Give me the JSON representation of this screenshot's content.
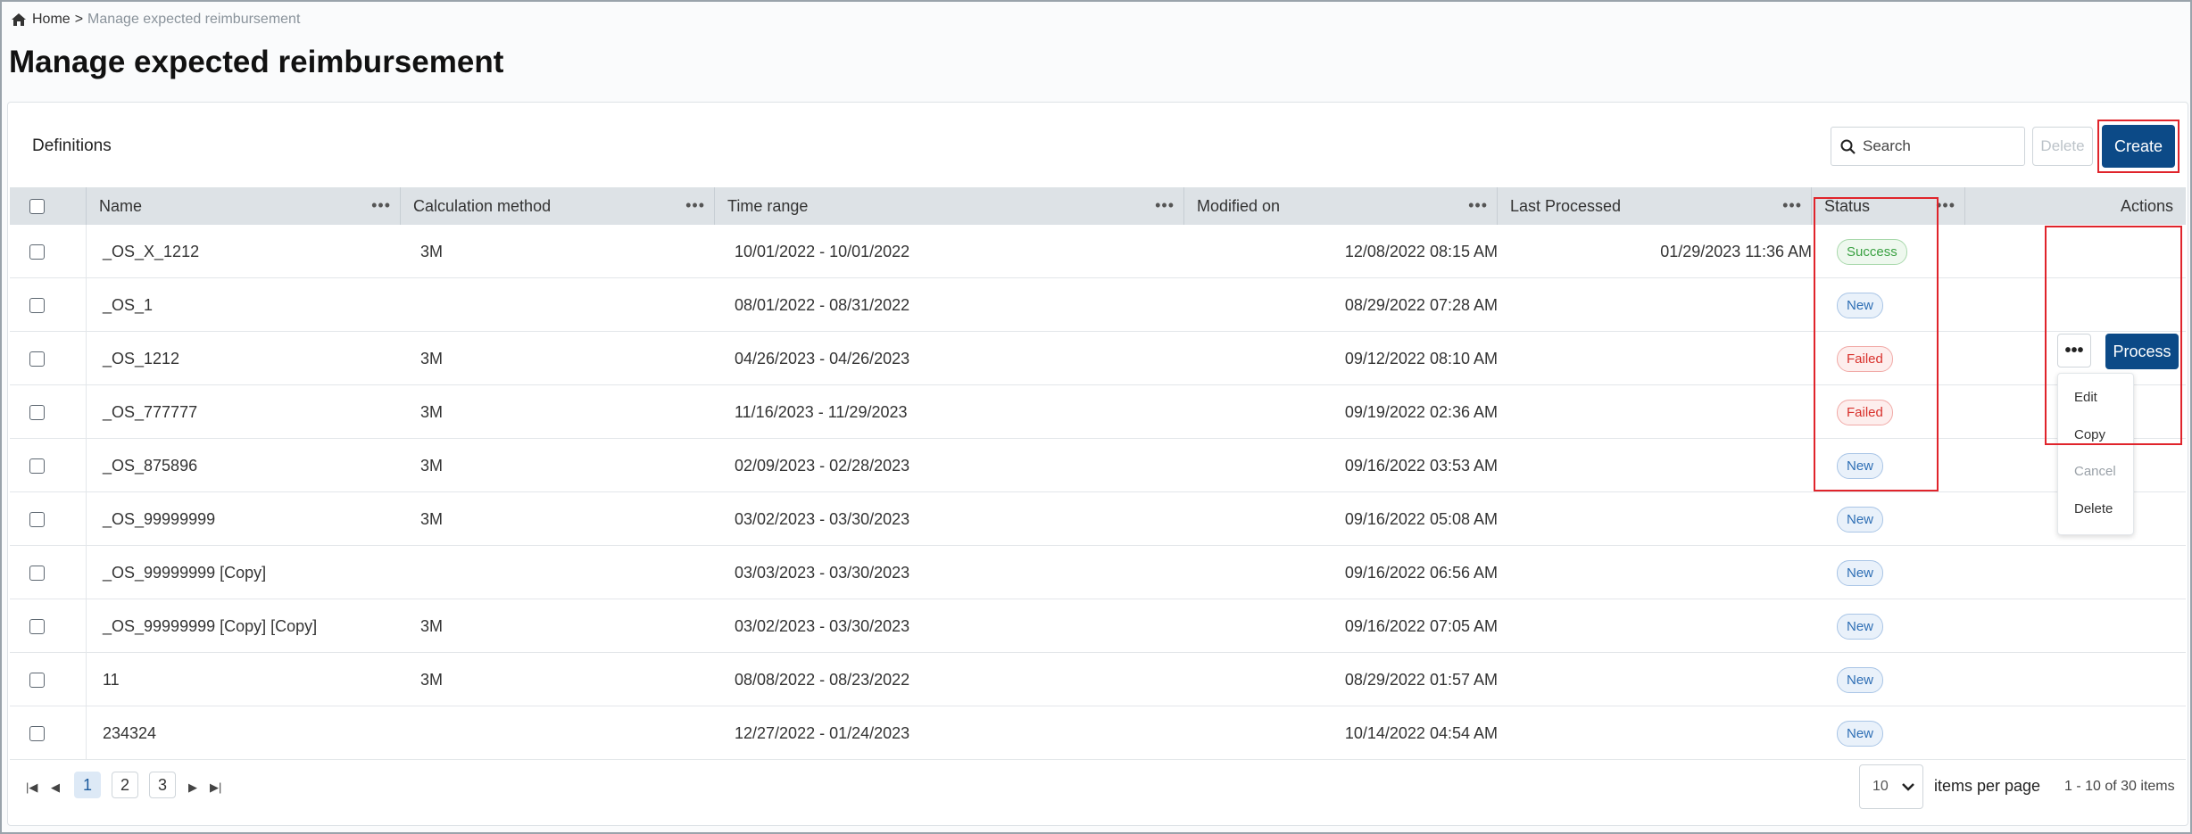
{
  "breadcrumb": {
    "home": "Home",
    "separator": ">",
    "current": "Manage expected reimbursement"
  },
  "page_title": "Manage expected reimbursement",
  "section_title": "Definitions",
  "toolbar": {
    "search_placeholder": "Search",
    "delete_label": "Delete",
    "create_label": "Create"
  },
  "columns": [
    "Name",
    "Calculation method",
    "Time range",
    "Modified on",
    "Last Processed",
    "Status",
    "Actions"
  ],
  "rows": [
    {
      "name": "_OS_X_1212",
      "method": "3M",
      "time_range": "10/01/2022 - 10/01/2022",
      "modified_on": "12/08/2022 08:15 AM",
      "last_processed": "01/29/2023 11:36 AM",
      "status": "Success"
    },
    {
      "name": "_OS_1",
      "method": "",
      "time_range": "08/01/2022 - 08/31/2022",
      "modified_on": "08/29/2022 07:28 AM",
      "last_processed": "",
      "status": "New"
    },
    {
      "name": "_OS_1212",
      "method": "3M",
      "time_range": "04/26/2023 - 04/26/2023",
      "modified_on": "09/12/2022 08:10 AM",
      "last_processed": "",
      "status": "Failed"
    },
    {
      "name": "_OS_777777",
      "method": "3M",
      "time_range": "11/16/2023 - 11/29/2023",
      "modified_on": "09/19/2022 02:36 AM",
      "last_processed": "",
      "status": "Failed"
    },
    {
      "name": "_OS_875896",
      "method": "3M",
      "time_range": "02/09/2023 - 02/28/2023",
      "modified_on": "09/16/2022 03:53 AM",
      "last_processed": "",
      "status": "New"
    },
    {
      "name": "_OS_99999999",
      "method": "3M",
      "time_range": "03/02/2023 - 03/30/2023",
      "modified_on": "09/16/2022 05:08 AM",
      "last_processed": "",
      "status": "New"
    },
    {
      "name": "_OS_99999999 [Copy]",
      "method": "",
      "time_range": "03/03/2023 - 03/30/2023",
      "modified_on": "09/16/2022 06:56 AM",
      "last_processed": "",
      "status": "New"
    },
    {
      "name": "_OS_99999999 [Copy] [Copy]",
      "method": "3M",
      "time_range": "03/02/2023 - 03/30/2023",
      "modified_on": "09/16/2022 07:05 AM",
      "last_processed": "",
      "status": "New"
    },
    {
      "name": "11",
      "method": "3M",
      "time_range": "08/08/2022 - 08/23/2022",
      "modified_on": "08/29/2022 01:57 AM",
      "last_processed": "",
      "status": "New"
    },
    {
      "name": "234324",
      "method": "",
      "time_range": "12/27/2022 - 01/24/2023",
      "modified_on": "10/14/2022 04:54 AM",
      "last_processed": "",
      "status": "New"
    }
  ],
  "row_actions": {
    "more_label": "•••",
    "process_label": "Process",
    "menu": [
      "Edit",
      "Copy",
      "Cancel",
      "Delete"
    ]
  },
  "pagination": {
    "pages": [
      "1",
      "2",
      "3"
    ],
    "current_page": "1",
    "page_size": "10",
    "items_per_page_label": "items per page",
    "range_label": "1 - 10 of 30 items"
  },
  "colors": {
    "primary": "#0c4a87",
    "highlight": "#e0242b",
    "header_bg": "#dde2e6",
    "success": "#3aa142",
    "new": "#2f6fb5",
    "failed": "#d8312c"
  },
  "icons": {
    "breadcrumb": "home-icon",
    "search": "search-icon",
    "page_size": "chevron-down-icon"
  }
}
